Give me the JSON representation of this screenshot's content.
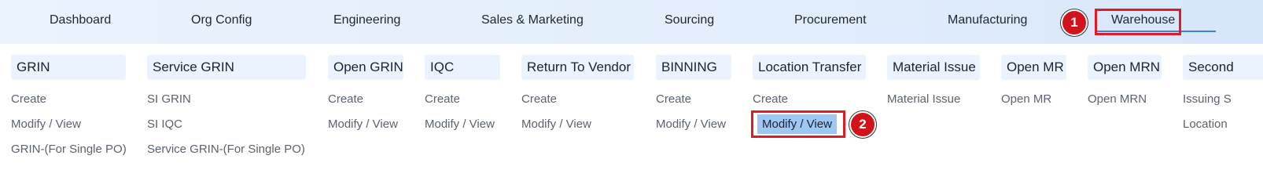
{
  "nav": {
    "items": [
      "Dashboard",
      "Org Config",
      "Engineering",
      "Sales & Marketing",
      "Sourcing",
      "Procurement",
      "Manufacturing",
      "Warehouse"
    ],
    "active": "Warehouse"
  },
  "annotations": {
    "badge1": "1",
    "badge2": "2"
  },
  "columns": [
    {
      "header": "GRIN",
      "items": [
        "Create",
        "Modify / View",
        "GRIN-(For Single PO)"
      ]
    },
    {
      "header": "Service GRIN",
      "items": [
        "SI GRIN",
        "SI IQC",
        "Service GRIN-(For Single PO)"
      ]
    },
    {
      "header": "Open GRIN",
      "items": [
        "Create",
        "Modify / View"
      ]
    },
    {
      "header": "IQC",
      "items": [
        "Create",
        "Modify / View"
      ]
    },
    {
      "header": "Return To Vendor",
      "items": [
        "Create",
        "Modify / View"
      ]
    },
    {
      "header": "BINNING",
      "items": [
        "Create",
        "Modify / View"
      ]
    },
    {
      "header": "Location Transfer",
      "items": [
        "Create",
        "Modify / View"
      ]
    },
    {
      "header": "Material Issue",
      "items": [
        "Material Issue"
      ]
    },
    {
      "header": "Open MR",
      "items": [
        "Open MR"
      ]
    },
    {
      "header": "Open MRN",
      "items": [
        "Open MRN"
      ]
    },
    {
      "header": "Second",
      "items": [
        "Issuing S",
        "Location"
      ]
    }
  ],
  "colors": {
    "highlight": "#e01b24",
    "accent": "#3f7fe0",
    "active_item_bg": "#9fc7f3"
  }
}
